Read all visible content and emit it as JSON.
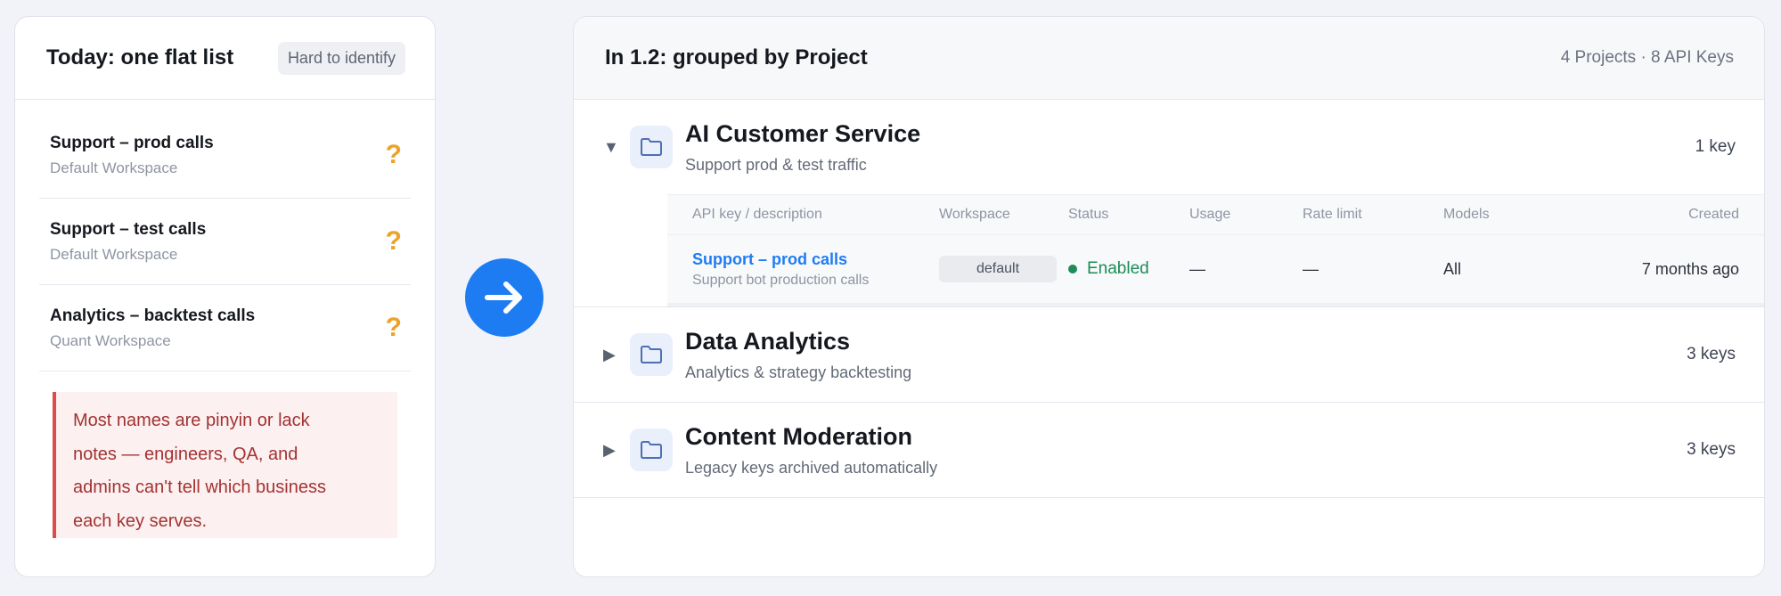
{
  "left": {
    "title": "Today: one flat list",
    "badge": "Hard to identify",
    "items": [
      {
        "name": "Support – prod calls",
        "workspace": "Default Workspace",
        "mark": "?"
      },
      {
        "name": "Support – test calls",
        "workspace": "Default Workspace",
        "mark": "?"
      },
      {
        "name": "Analytics – backtest calls",
        "workspace": "Quant Workspace",
        "mark": "?"
      }
    ],
    "warning_lines": [
      "Most names are pinyin or lack",
      "notes — engineers, QA, and",
      "admins can't tell which business",
      "each key serves."
    ]
  },
  "arrow": {
    "icon": "arrow-right-icon"
  },
  "right": {
    "title": "In 1.2: grouped by Project",
    "summary": "4 Projects · 8 API Keys",
    "projects": [
      {
        "name": "AI Customer Service",
        "description": "Support prod & test traffic",
        "count": "1 key",
        "expanded": "▼"
      },
      {
        "name": "Data Analytics",
        "description": "Analytics & strategy backtesting",
        "count": "3 keys",
        "expanded": "▶"
      },
      {
        "name": "Content Moderation",
        "description": "Legacy keys archived automatically",
        "count": "3 keys",
        "expanded": "▶"
      }
    ],
    "table": {
      "headers": [
        "API key / description",
        "Workspace",
        "Status",
        "Usage",
        "Rate limit",
        "Models",
        "Created"
      ],
      "rows": [
        {
          "name": "Support – prod calls",
          "description": "Support bot production calls",
          "workspace": "default",
          "status": "Enabled",
          "usage": "—",
          "rate_limit": "—",
          "models": "All",
          "created": "7 months ago"
        }
      ]
    }
  },
  "colors": {
    "accent": "#1e7cf3",
    "warning": "#eda229",
    "error": "#dd4b4b",
    "success": "#1d8c57"
  }
}
